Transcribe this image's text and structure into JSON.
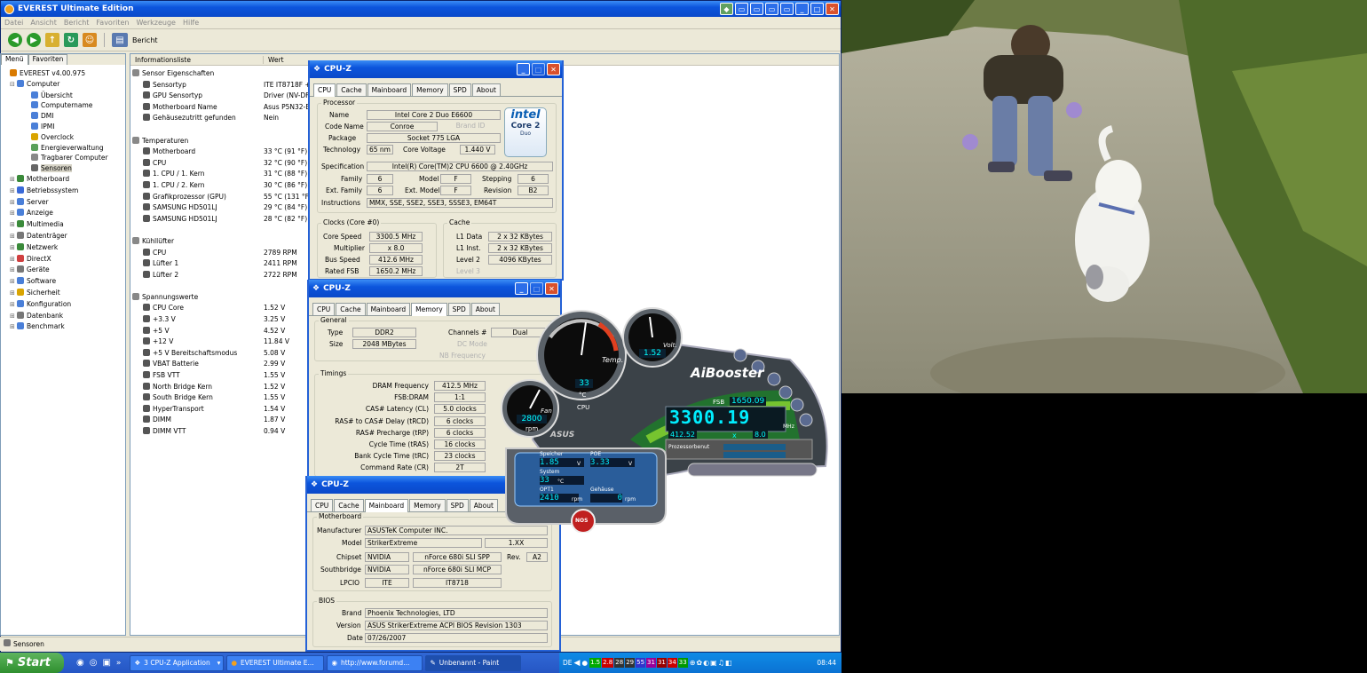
{
  "everest": {
    "title": "EVEREST Ultimate Edition",
    "menu": [
      "Datei",
      "Ansicht",
      "Bericht",
      "Favoriten",
      "Werkzeuge",
      "Hilfe"
    ],
    "toolbar_report": "Bericht",
    "tabs": [
      "Menü",
      "Favoriten"
    ],
    "tree": [
      {
        "label": "EVEREST v4.00.975",
        "indent": 0,
        "color": "#d97a00"
      },
      {
        "label": "Computer",
        "indent": 1,
        "color": "#4a7fd8"
      },
      {
        "label": "Übersicht",
        "indent": 3,
        "color": "#4a7fd8"
      },
      {
        "label": "Computername",
        "indent": 3,
        "color": "#4a7fd8"
      },
      {
        "label": "DMI",
        "indent": 3,
        "color": "#4a7fd8"
      },
      {
        "label": "IPMI",
        "indent": 3,
        "color": "#4a7fd8"
      },
      {
        "label": "Overclock",
        "indent": 3,
        "color": "#d9a400"
      },
      {
        "label": "Energieverwaltung",
        "indent": 3,
        "color": "#5aa05a"
      },
      {
        "label": "Tragbarer Computer",
        "indent": 3,
        "color": "#888888"
      },
      {
        "label": "Sensoren",
        "indent": 3,
        "color": "#666666"
      },
      {
        "label": "Motherboard",
        "indent": 1,
        "color": "#3a8a3a"
      },
      {
        "label": "Betriebssystem",
        "indent": 1,
        "color": "#3a6ad8"
      },
      {
        "label": "Server",
        "indent": 1,
        "color": "#4a7fd8"
      },
      {
        "label": "Anzeige",
        "indent": 1,
        "color": "#4a7fd8"
      },
      {
        "label": "Multimedia",
        "indent": 1,
        "color": "#3a8a3a"
      },
      {
        "label": "Datenträger",
        "indent": 1,
        "color": "#777777"
      },
      {
        "label": "Netzwerk",
        "indent": 1,
        "color": "#3a8a3a"
      },
      {
        "label": "DirectX",
        "indent": 1,
        "color": "#d04040"
      },
      {
        "label": "Geräte",
        "indent": 1,
        "color": "#777777"
      },
      {
        "label": "Software",
        "indent": 1,
        "color": "#4a7fd8"
      },
      {
        "label": "Sicherheit",
        "indent": 1,
        "color": "#d9a400"
      },
      {
        "label": "Konfiguration",
        "indent": 1,
        "color": "#4a7fd8"
      },
      {
        "label": "Datenbank",
        "indent": 1,
        "color": "#777777"
      },
      {
        "label": "Benchmark",
        "indent": 1,
        "color": "#4a7fd8"
      }
    ],
    "columns": [
      "Informationsliste",
      "Wert"
    ],
    "rows": [
      {
        "n": "Sensor Eigenschaften",
        "v": "",
        "sec": true
      },
      {
        "n": "Sensortyp",
        "v": "ITE IT8718F +"
      },
      {
        "n": "GPU Sensortyp",
        "v": "Driver (NV-DF"
      },
      {
        "n": "Motherboard Name",
        "v": "Asus P5N32-E"
      },
      {
        "n": "Gehäusezutritt gefunden",
        "v": "Nein"
      },
      {
        "n": "",
        "v": ""
      },
      {
        "n": "Temperaturen",
        "v": "",
        "sec": true
      },
      {
        "n": "Motherboard",
        "v": "33 °C (91 °F)"
      },
      {
        "n": "CPU",
        "v": "32 °C (90 °F)"
      },
      {
        "n": "1. CPU / 1. Kern",
        "v": "31 °C (88 °F)"
      },
      {
        "n": "1. CPU / 2. Kern",
        "v": "30 °C (86 °F)"
      },
      {
        "n": "Grafikprozessor (GPU)",
        "v": "55 °C (131 °F)"
      },
      {
        "n": "SAMSUNG HD501LJ",
        "v": "29 °C (84 °F)"
      },
      {
        "n": "SAMSUNG HD501LJ",
        "v": "28 °C (82 °F)"
      },
      {
        "n": "",
        "v": ""
      },
      {
        "n": "Kühllüfter",
        "v": "",
        "sec": true
      },
      {
        "n": "CPU",
        "v": "2789 RPM"
      },
      {
        "n": "Lüfter 1",
        "v": "2411 RPM"
      },
      {
        "n": "Lüfter 2",
        "v": "2722 RPM"
      },
      {
        "n": "",
        "v": ""
      },
      {
        "n": "Spannungswerte",
        "v": "",
        "sec": true
      },
      {
        "n": "CPU Core",
        "v": "1.52 V"
      },
      {
        "n": "+3.3 V",
        "v": "3.25 V"
      },
      {
        "n": "+5 V",
        "v": "4.52 V"
      },
      {
        "n": "+12 V",
        "v": "11.84 V"
      },
      {
        "n": "+5 V Bereitschaftsmodus",
        "v": "5.08 V"
      },
      {
        "n": "VBAT Batterie",
        "v": "2.99 V"
      },
      {
        "n": "FSB VTT",
        "v": "1.55 V"
      },
      {
        "n": "North Bridge Kern",
        "v": "1.52 V"
      },
      {
        "n": "South Bridge Kern",
        "v": "1.55 V"
      },
      {
        "n": "HyperTransport",
        "v": "1.54 V"
      },
      {
        "n": "DIMM",
        "v": "1.87 V"
      },
      {
        "n": "DIMM VTT",
        "v": "0.94 V"
      }
    ],
    "status": "Sensoren"
  },
  "cpuz_tabs": [
    "CPU",
    "Cache",
    "Mainboard",
    "Memory",
    "SPD",
    "About"
  ],
  "cpuz_title": "CPU-Z",
  "cpu": {
    "processor_group": "Processor",
    "name_l": "Name",
    "name": "Intel Core 2 Duo E6600",
    "codename_l": "Code Name",
    "codename": "Conroe",
    "brandid_l": "Brand ID",
    "package_l": "Package",
    "package": "Socket 775 LGA",
    "tech_l": "Technology",
    "tech": "65 nm",
    "cv_l": "Core Voltage",
    "cv": "1.440 V",
    "spec_l": "Specification",
    "spec": "Intel(R) Core(TM)2 CPU       6600  @ 2.40GHz",
    "family_l": "Family",
    "family": "6",
    "model_l": "Model",
    "model": "F",
    "stepping_l": "Stepping",
    "stepping": "6",
    "extfam_l": "Ext. Family",
    "extfam": "6",
    "extmod_l": "Ext. Model",
    "extmod": "F",
    "rev_l": "Revision",
    "rev": "B2",
    "instr_l": "Instructions",
    "instr": "MMX, SSE, SSE2, SSE3, SSSE3, EM64T",
    "clocks_group": "Clocks (Core #0)",
    "cs_l": "Core Speed",
    "cs": "3300.5 MHz",
    "mult_l": "Multiplier",
    "mult": "x 8.0",
    "bus_l": "Bus Speed",
    "bus": "412.6 MHz",
    "fsb_l": "Rated FSB",
    "fsb": "1650.2 MHz",
    "cache_group": "Cache",
    "l1d_l": "L1 Data",
    "l1d": "2 x 32 KBytes",
    "l1i_l": "L1 Inst.",
    "l1i": "2 x 32 KBytes",
    "l2_l": "Level 2",
    "l2": "4096 KBytes",
    "l3_l": "Level 3",
    "logo1": "intel",
    "logo2": "Core 2",
    "logo3": "Duo"
  },
  "mem": {
    "general": "General",
    "type_l": "Type",
    "type": "DDR2",
    "size_l": "Size",
    "size": "2048 MBytes",
    "ch_l": "Channels #",
    "ch": "Dual",
    "dc_l": "DC Mode",
    "nb_l": "NB Frequency",
    "timings": "Timings",
    "t": [
      [
        "DRAM Frequency",
        "412.5 MHz"
      ],
      [
        "FSB:DRAM",
        "1:1"
      ],
      [
        "CAS# Latency (CL)",
        "5.0 clocks"
      ],
      [
        "RAS# to CAS# Delay (tRCD)",
        "6 clocks"
      ],
      [
        "RAS# Precharge (tRP)",
        "6 clocks"
      ],
      [
        "Cycle Time (tRAS)",
        "16 clocks"
      ],
      [
        "Bank Cycle Time (tRC)",
        "23 clocks"
      ],
      [
        "Command Rate (CR)",
        "2T"
      ]
    ]
  },
  "mb": {
    "mobo": "Motherboard",
    "man_l": "Manufacturer",
    "man": "ASUSTeK Computer INC.",
    "model_l": "Model",
    "model": "StrikerExtreme",
    "model_rev": "1.XX",
    "chip_l": "Chipset",
    "chip_v": "NVIDIA",
    "chip_m": "nForce 680i SLI SPP",
    "rev_l": "Rev.",
    "rev": "A2",
    "sb_l": "Southbridge",
    "sb_v": "NVIDIA",
    "sb_m": "nForce 680i SLI MCP",
    "lpc_l": "LPCIO",
    "lpc_v": "ITE",
    "lpc_m": "IT8718",
    "bios": "BIOS",
    "brand_l": "Brand",
    "brand": "Phoenix Technologies, LTD",
    "ver_l": "Version",
    "ver": "ASUS StrikerExtreme ACPI BIOS Revision 1303",
    "date_l": "Date",
    "date": "07/26/2007"
  },
  "ai": {
    "temp_label": "Temp.",
    "temp": "33",
    "unit_c": "°C",
    "cpu": "CPU",
    "volt_label": "Volt.",
    "volt": "1.52",
    "fan_label": "Fan",
    "fan": "2800",
    "rpm": "rpm",
    "brand": "AiBooster",
    "fsb_label": "FSB",
    "fsb": "1650.09",
    "freq": "3300.19",
    "mhz": "MHz",
    "bus": "412.52",
    "x": "x",
    "mult": "8.0",
    "load": "Prozessorbenut",
    "asus": "ASUS",
    "speicher": "Speicher",
    "speicher_v": "1.85",
    "poe": "POE",
    "poe_v": "3.33",
    "system": "System",
    "system_v": "33",
    "opt1": "OPT1",
    "opt1_v": "2410",
    "gehause": "Gehäuse",
    "gehause_v": "0",
    "v": "V",
    "rpm2": "rpm",
    "nos": "NOS"
  },
  "taskbar": {
    "start": "Start",
    "tasks": [
      "3 CPU-Z Application",
      "EVEREST Ultimate E...",
      "http://www.forumd...",
      "Unbenannt - Paint"
    ],
    "lang": "DE",
    "tray_nums": [
      {
        "t": "1.5",
        "c": "#00aa00"
      },
      {
        "t": "2.8",
        "c": "#cc0000"
      },
      {
        "t": "28",
        "c": "#333333"
      },
      {
        "t": "29",
        "c": "#333333"
      },
      {
        "t": "55",
        "c": "#3333cc"
      },
      {
        "t": "31",
        "c": "#990099"
      },
      {
        "t": "31",
        "c": "#990000"
      },
      {
        "t": "34",
        "c": "#cc0000"
      },
      {
        "t": "33",
        "c": "#009900"
      }
    ],
    "clock": "08:44"
  }
}
